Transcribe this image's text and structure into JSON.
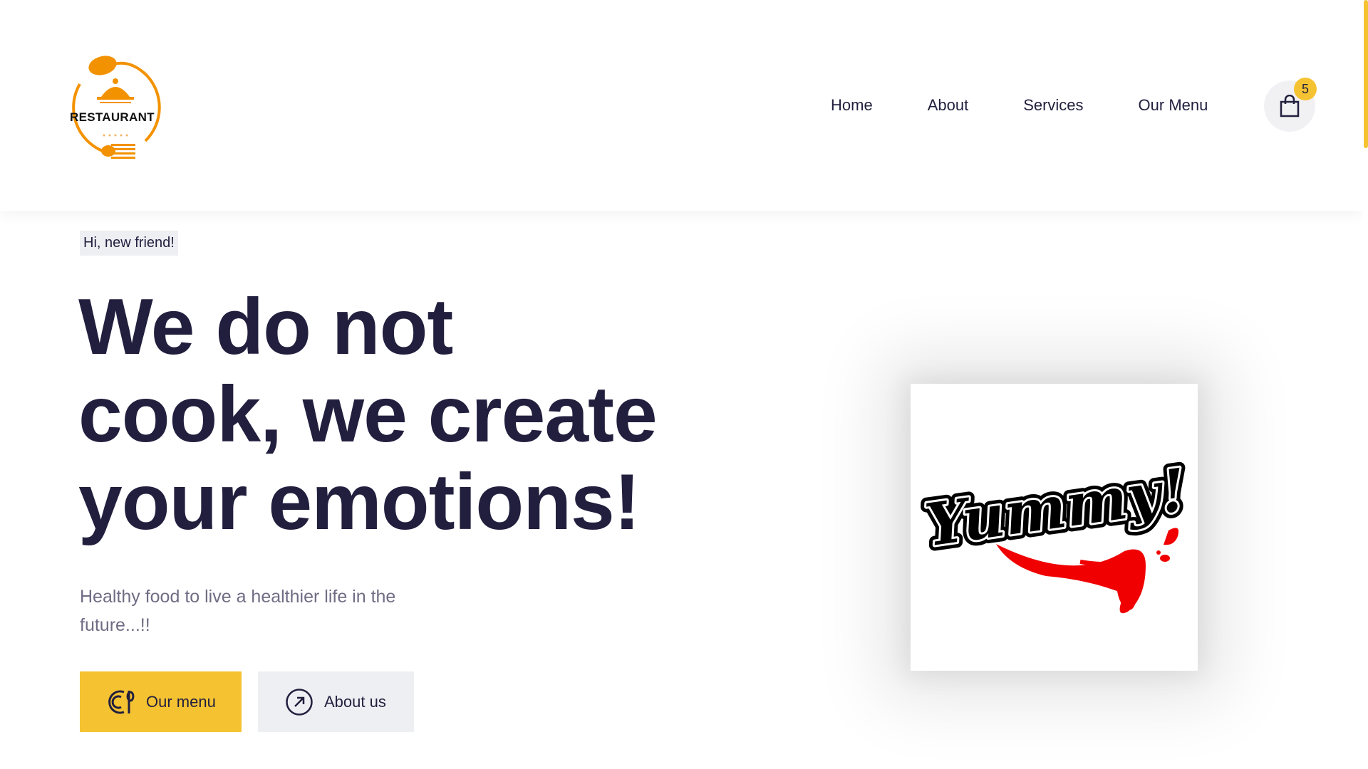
{
  "brand": {
    "logo_text": "RESTAURANT",
    "accent_color": "#f5c332",
    "logo_color": "#f39200",
    "text_color": "#221f3e"
  },
  "nav": {
    "items": [
      {
        "label": "Home"
      },
      {
        "label": "About"
      },
      {
        "label": "Services"
      },
      {
        "label": "Our Menu"
      }
    ]
  },
  "cart": {
    "icon": "shopping-bag-icon",
    "count": "5"
  },
  "hero": {
    "tagline": "Hi, new friend!",
    "title_lines": [
      "We do not",
      "cook, we create",
      "your emotions!"
    ],
    "subtitle": "Healthy food to live a healthier life in the future...!!",
    "buttons": {
      "menu": {
        "label": "Our menu",
        "icon": "dish-icon"
      },
      "about": {
        "label": "About us",
        "icon": "arrow-up-right-circle-icon"
      }
    },
    "image": {
      "logo_text": "Yummy!"
    }
  }
}
